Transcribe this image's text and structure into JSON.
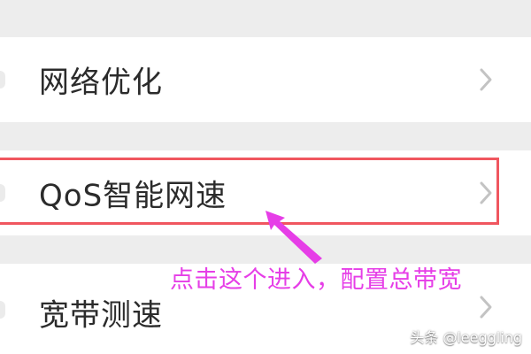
{
  "menu": {
    "items": [
      {
        "label": "网络优化",
        "icon": "chevron-right-icon"
      },
      {
        "label": "QoS智能网速",
        "icon": "chevron-right-icon"
      },
      {
        "label": "宽带测速",
        "icon": "chevron-right-icon"
      }
    ]
  },
  "annotation": {
    "text": "点击这个进入，配置总带宽",
    "box_color": "#f0565f",
    "text_color": "#e63ee7"
  },
  "watermark": {
    "text": "头条 @leeggling"
  },
  "colors": {
    "background": "#ededed",
    "item_background": "#ffffff",
    "label": "#2b2b2b",
    "chevron": "#c3c3c3"
  }
}
